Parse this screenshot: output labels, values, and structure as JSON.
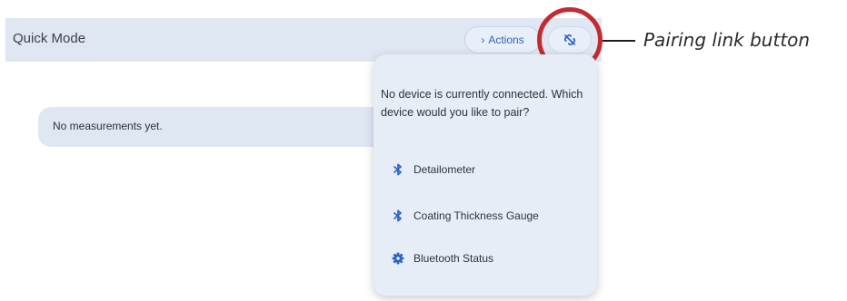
{
  "header": {
    "title": "Quick Mode",
    "actions_label": "Actions"
  },
  "measurements": {
    "empty_text": "No measurements yet."
  },
  "popup": {
    "message": "No device is currently connected. Which device would you like to pair?",
    "items": [
      {
        "label": "Detailometer",
        "icon": "bluetooth-icon"
      },
      {
        "label": "Coating Thickness Gauge",
        "icon": "bluetooth-icon"
      },
      {
        "label": "Bluetooth Status",
        "icon": "gear-icon"
      }
    ]
  },
  "annotation": {
    "label": "Pairing link button",
    "color": "#c22b32"
  },
  "colors": {
    "accent": "#3262b8",
    "icon": "#2a63c4"
  }
}
